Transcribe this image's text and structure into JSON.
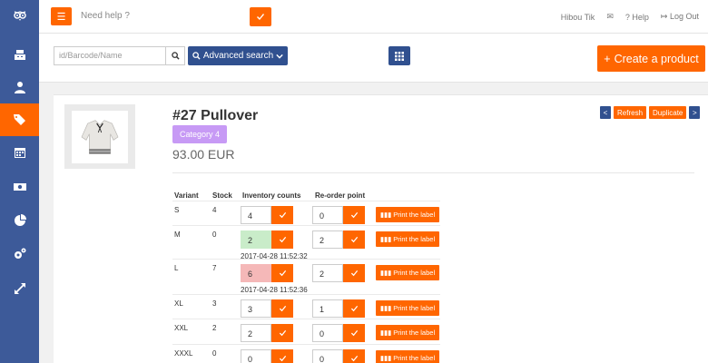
{
  "header": {
    "help_placeholder": "Need help ?",
    "user_name": "Hibou Tik",
    "help_label": "Help",
    "logout_label": "Log Out"
  },
  "toolbar": {
    "search_placeholder": "id/Barcode/Name",
    "advanced_search_label": "Advanced search",
    "create_product_label": "Create a product"
  },
  "colors": {
    "sidebar": "#3d5a99",
    "accent": "#ff6600",
    "primary_button": "#30508f",
    "category_badge": "#c79af5",
    "count_ok": "#c9ecc9",
    "count_low": "#f5b8b8"
  },
  "product": {
    "title": "#27 Pullover",
    "category": "Category 4",
    "price": "93.00 EUR",
    "nav_prev": "<",
    "nav_next": ">",
    "refresh_label": "Refresh",
    "duplicate_label": "Duplicate"
  },
  "table": {
    "headers": {
      "variant": "Variant",
      "stock": "Stock",
      "inventory": "Inventory counts",
      "reorder": "Re-order point"
    },
    "print_label": "Print the label",
    "rows": [
      {
        "variant": "S",
        "stock": "4",
        "count": "4",
        "reorder": "0",
        "timestamp": ""
      },
      {
        "variant": "M",
        "stock": "0",
        "count": "2",
        "reorder": "2",
        "timestamp": "2017-04-28 11:52:32"
      },
      {
        "variant": "L",
        "stock": "7",
        "count": "6",
        "reorder": "2",
        "timestamp": "2017-04-28 11:52:36"
      },
      {
        "variant": "XL",
        "stock": "3",
        "count": "3",
        "reorder": "1",
        "timestamp": ""
      },
      {
        "variant": "XXL",
        "stock": "2",
        "count": "2",
        "reorder": "0",
        "timestamp": ""
      },
      {
        "variant": "XXXL",
        "stock": "0",
        "count": "0",
        "reorder": "0",
        "timestamp": ""
      }
    ]
  },
  "icons": {
    "sidebar": [
      "owl-logo-icon",
      "cash-register-icon",
      "user-icon",
      "tags-icon",
      "calendar-icon",
      "money-icon",
      "pie-chart-icon",
      "cogs-icon",
      "expand-icon"
    ]
  }
}
